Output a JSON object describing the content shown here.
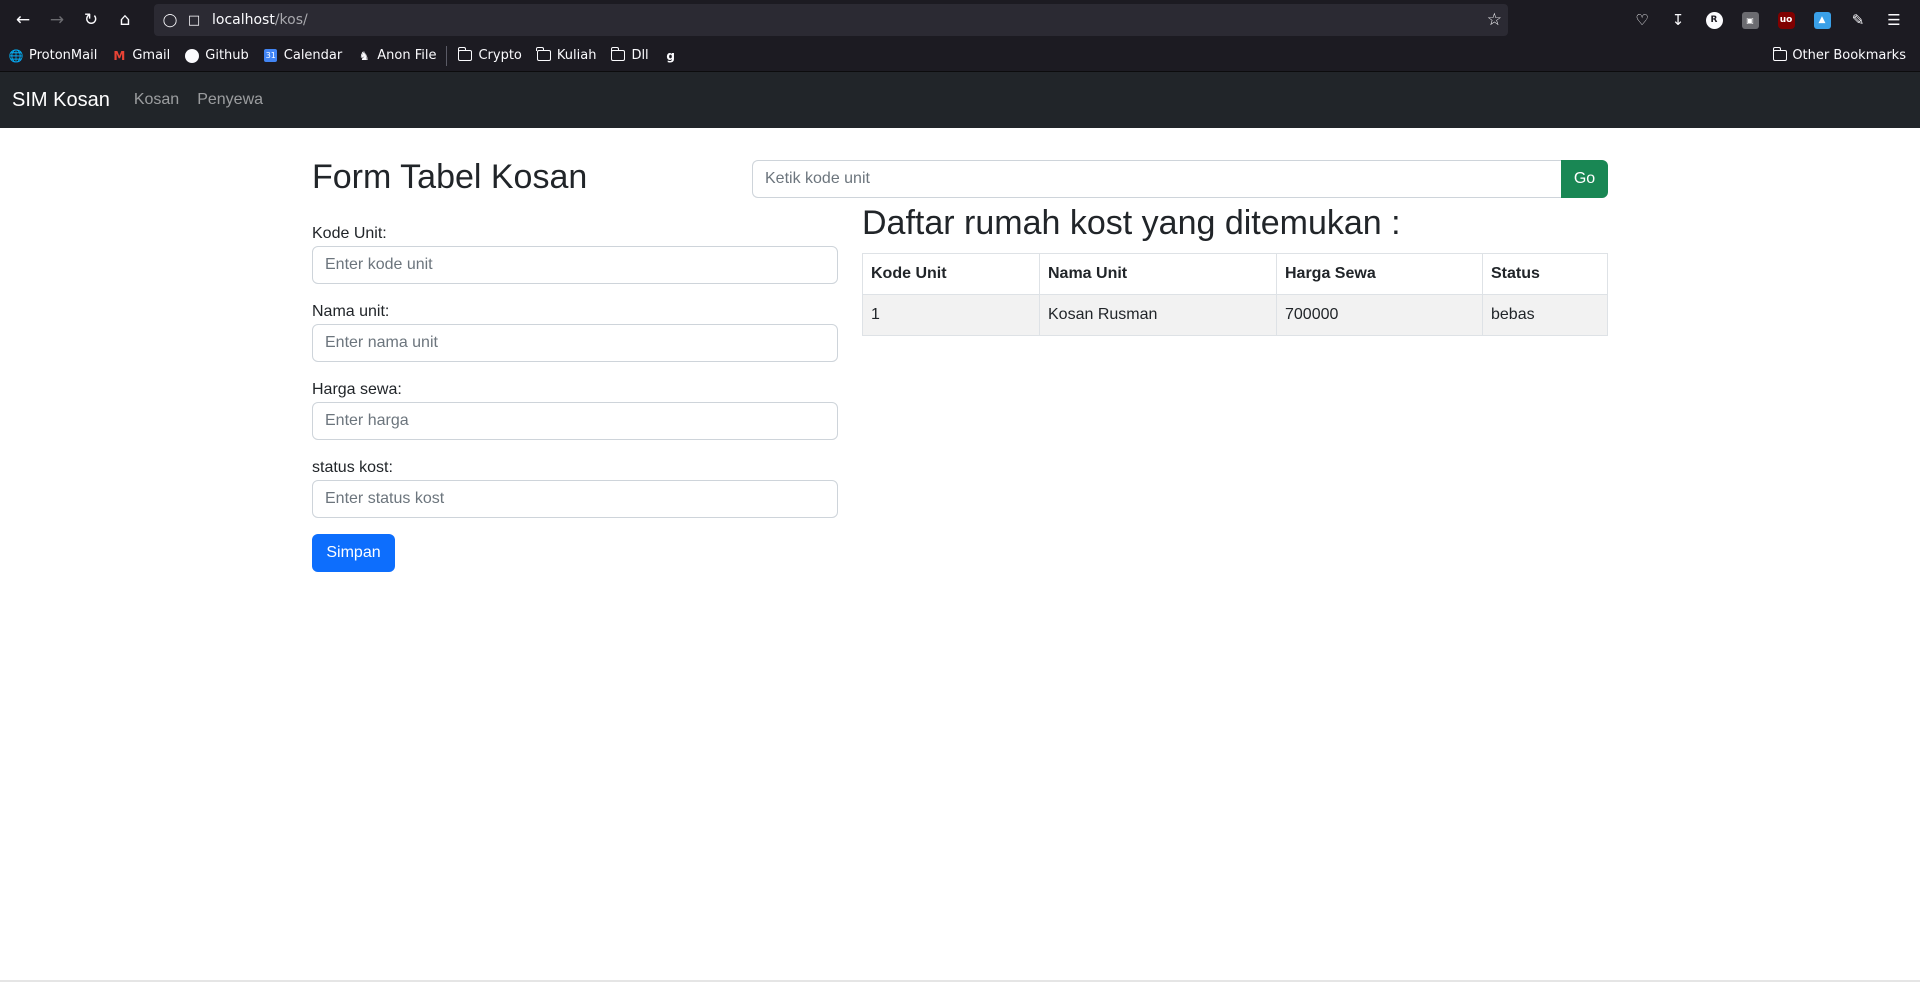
{
  "browser": {
    "url_host": "localhost",
    "url_path": "/kos/",
    "bookmarks": [
      {
        "label": "ProtonMail",
        "icon": "globe-icon"
      },
      {
        "label": "Gmail",
        "icon": "gmail-icon"
      },
      {
        "label": "Github",
        "icon": "github-icon"
      },
      {
        "label": "Calendar",
        "icon": "calendar-icon"
      },
      {
        "label": "Anon File",
        "icon": "anonfile-icon"
      },
      {
        "label": "Crypto",
        "icon": "folder-icon"
      },
      {
        "label": "Kuliah",
        "icon": "folder-icon"
      },
      {
        "label": "Dll",
        "icon": "folder-icon"
      }
    ],
    "other_bookmarks": "Other Bookmarks"
  },
  "navbar": {
    "brand": "SIM Kosan",
    "links": [
      "Kosan",
      "Penyewa"
    ]
  },
  "form": {
    "title": "Form Tabel Kosan",
    "fields": [
      {
        "label": "Kode Unit:",
        "placeholder": "Enter kode unit",
        "value": ""
      },
      {
        "label": "Nama unit:",
        "placeholder": "Enter nama unit",
        "value": ""
      },
      {
        "label": "Harga sewa:",
        "placeholder": "Enter harga",
        "value": ""
      },
      {
        "label": "status kost:",
        "placeholder": "Enter status kost",
        "value": ""
      }
    ],
    "submit_label": "Simpan"
  },
  "search": {
    "placeholder": "Ketik kode unit",
    "button_label": "Go"
  },
  "results": {
    "title": "Daftar rumah kost yang ditemukan :",
    "columns": [
      "Kode Unit",
      "Nama Unit",
      "Harga Sewa",
      "Status"
    ],
    "rows": [
      [
        "1",
        "Kosan Rusman",
        "700000",
        "bebas"
      ]
    ]
  },
  "colors": {
    "primary": "#0d6efd",
    "success": "#198754",
    "navbar_bg": "#212529"
  }
}
